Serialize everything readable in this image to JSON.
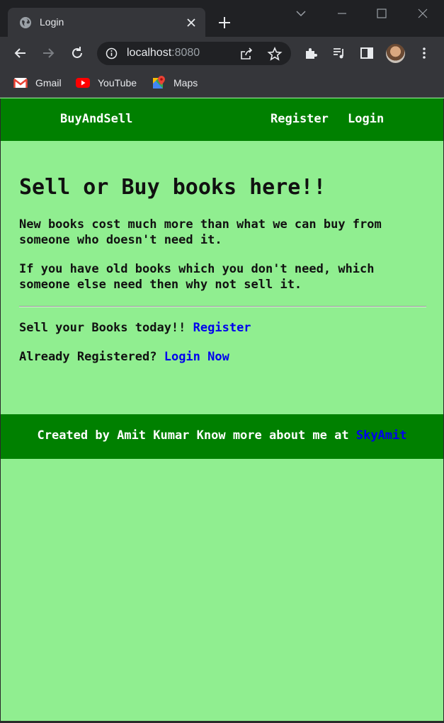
{
  "browser": {
    "tab_title": "Login",
    "url_host": "localhost",
    "url_port": ":8080",
    "bookmarks": [
      {
        "label": "Gmail",
        "icon": "gmail-icon"
      },
      {
        "label": "YouTube",
        "icon": "youtube-icon"
      },
      {
        "label": "Maps",
        "icon": "maps-icon"
      }
    ]
  },
  "navbar": {
    "brand": "BuyAndSell",
    "register": "Register",
    "login": "Login"
  },
  "main": {
    "heading": "Sell or Buy books here!!",
    "para1": "New books cost much more than what we can buy from someone who doesn't need it.",
    "para2": "If you have old books which you don't need, which someone else need then why not sell it.",
    "sell_text": "Sell your Books today!!",
    "sell_link": "Register",
    "registered_text": "Already Registered?",
    "login_link": "Login Now"
  },
  "footer": {
    "text": "Created by Amit Kumar Know more about me at",
    "link": "SkyAmit"
  },
  "colors": {
    "page_bg": "#90ee90",
    "bar_green": "#008000",
    "link_blue": "#0000ee"
  }
}
